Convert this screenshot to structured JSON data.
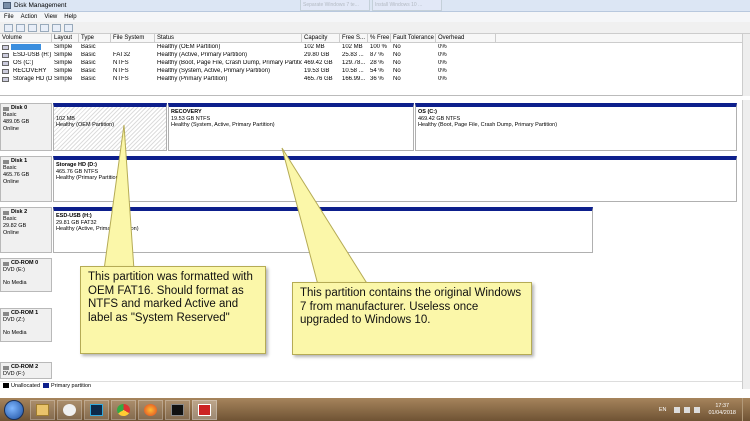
{
  "window": {
    "title": "Disk Management"
  },
  "background_tabs": [
    "Separate Windows 7 te...",
    "Install Windows 10 ..."
  ],
  "menu": [
    "File",
    "Action",
    "View",
    "Help"
  ],
  "volume_table": {
    "columns": [
      "Volume",
      "Layout",
      "Type",
      "File System",
      "Status",
      "Capacity",
      "Free S...",
      "% Free",
      "Fault Tolerance",
      "Overhead"
    ],
    "rows": [
      {
        "volume": "",
        "layout": "Simple",
        "type": "Basic",
        "fs": "",
        "status": "Healthy (OEM Partition)",
        "capacity": "102 MB",
        "free": "102 MB",
        "pct": "100 %",
        "fault": "No",
        "overhead": "0%"
      },
      {
        "volume": "ESD-USB (H:)",
        "layout": "Simple",
        "type": "Basic",
        "fs": "FAT32",
        "status": "Healthy (Active, Primary Partition)",
        "capacity": "29.80 GB",
        "free": "25.83 ...",
        "pct": "87 %",
        "fault": "No",
        "overhead": "0%"
      },
      {
        "volume": "OS (C:)",
        "layout": "Simple",
        "type": "Basic",
        "fs": "NTFS",
        "status": "Healthy (Boot, Page File, Crash Dump, Primary Partition)",
        "capacity": "469.42 GB",
        "free": "129.78...",
        "pct": "28 %",
        "fault": "No",
        "overhead": "0%"
      },
      {
        "volume": "RECOVERY",
        "layout": "Simple",
        "type": "Basic",
        "fs": "NTFS",
        "status": "Healthy (System, Active, Primary Partition)",
        "capacity": "19.53 GB",
        "free": "10.58 ...",
        "pct": "54 %",
        "fault": "No",
        "overhead": "0%"
      },
      {
        "volume": "Storage HD (D:)",
        "layout": "Simple",
        "type": "Basic",
        "fs": "NTFS",
        "status": "Healthy (Primary Partition)",
        "capacity": "465.76 GB",
        "free": "166.99...",
        "pct": "36 %",
        "fault": "No",
        "overhead": "0%"
      }
    ]
  },
  "disks": [
    {
      "name": "Disk 0",
      "type": "Basic",
      "size": "489.05 GB",
      "state": "Online",
      "partitions": [
        {
          "name": "",
          "size": "102 MB",
          "status": "Healthy (OEM Partition)"
        },
        {
          "name": "RECOVERY",
          "size": "19.53 GB NTFS",
          "status": "Healthy (System, Active, Primary Partition)"
        },
        {
          "name": "OS  (C:)",
          "size": "469.42 GB NTFS",
          "status": "Healthy (Boot, Page File, Crash Dump, Primary Partition)"
        }
      ]
    },
    {
      "name": "Disk 1",
      "type": "Basic",
      "size": "465.76 GB",
      "state": "Online",
      "partitions": [
        {
          "name": "Storage HD  (D:)",
          "size": "465.76 GB NTFS",
          "status": "Healthy (Primary Partition)"
        }
      ]
    },
    {
      "name": "Disk 2",
      "type": "Basic",
      "size": "29.82 GB",
      "state": "Online",
      "partitions": [
        {
          "name": "ESD-USB  (H:)",
          "size": "29.81 GB FAT32",
          "status": "Healthy (Active, Primary Partition)"
        }
      ]
    },
    {
      "name": "CD-ROM 0",
      "type": "DVD (E:)",
      "state": "No Media"
    },
    {
      "name": "CD-ROM 1",
      "type": "DVD (Z:)",
      "state": "No Media"
    },
    {
      "name": "CD-ROM 2",
      "type": "DVD (F:)"
    }
  ],
  "legend": {
    "unallocated": "Unallocated",
    "primary": "Primary partition"
  },
  "callouts": {
    "left": "This partition was formatted with OEM FAT16. Should format as NTFS and marked Active and label as \"System Reserved\"",
    "right": "This partition contains the original Windows 7 from manufacturer. Useless once upgraded to Windows 10."
  },
  "taskbar": {
    "apps": [
      "explorer-icon",
      "paint-icon",
      "photoshop-icon",
      "chrome-icon",
      "firefox-icon",
      "cmd-icon",
      "disk-management-icon"
    ],
    "lang": "EN",
    "time": "17:37",
    "date": "01/04/2018"
  },
  "colors": {
    "primary_partition": "#0d1f8c",
    "unallocated": "#000000",
    "callout": "#fbf7a9"
  }
}
